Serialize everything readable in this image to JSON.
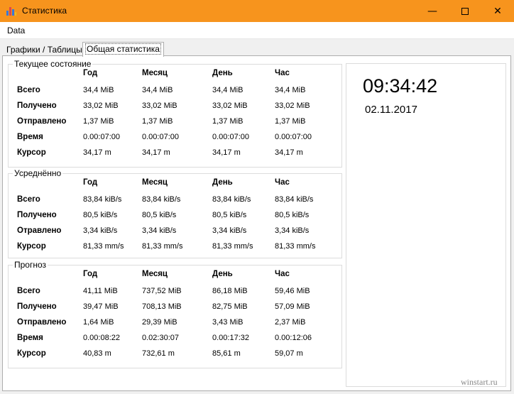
{
  "window": {
    "title": "Статистика"
  },
  "menu": {
    "items": [
      "Data"
    ]
  },
  "tabs": [
    "Графики / Таблицы",
    "Общая статистика"
  ],
  "columns": [
    "Год",
    "Месяц",
    "День",
    "Час"
  ],
  "groups": [
    {
      "title": "Текущее состояние",
      "rows": [
        {
          "label": "Всего",
          "values": [
            "34,4 MiB",
            "34,4 MiB",
            "34,4 MiB",
            "34,4 MiB"
          ]
        },
        {
          "label": "Получено",
          "values": [
            "33,02 MiB",
            "33,02 MiB",
            "33,02 MiB",
            "33,02 MiB"
          ]
        },
        {
          "label": "Отправлено",
          "values": [
            "1,37 MiB",
            "1,37 MiB",
            "1,37 MiB",
            "1,37 MiB"
          ]
        },
        {
          "label": "Время",
          "values": [
            "0.00:07:00",
            "0.00:07:00",
            "0.00:07:00",
            "0.00:07:00"
          ]
        },
        {
          "label": "Курсор",
          "values": [
            "34,17 m",
            "34,17 m",
            "34,17 m",
            "34,17 m"
          ]
        }
      ]
    },
    {
      "title": "Усреднённо",
      "rows": [
        {
          "label": "Всего",
          "values": [
            "83,84 kiB/s",
            "83,84 kiB/s",
            "83,84 kiB/s",
            "83,84 kiB/s"
          ]
        },
        {
          "label": "Получено",
          "values": [
            "80,5 kiB/s",
            "80,5 kiB/s",
            "80,5 kiB/s",
            "80,5 kiB/s"
          ]
        },
        {
          "label": "Отравлено",
          "values": [
            "3,34 kiB/s",
            "3,34 kiB/s",
            "3,34 kiB/s",
            "3,34 kiB/s"
          ]
        },
        {
          "label": "Курсор",
          "values": [
            "81,33 mm/s",
            "81,33 mm/s",
            "81,33 mm/s",
            "81,33 mm/s"
          ]
        }
      ]
    },
    {
      "title": "Прогноз",
      "rows": [
        {
          "label": "Всего",
          "values": [
            "41,11 MiB",
            "737,52 MiB",
            "86,18 MiB",
            "59,46 MiB"
          ]
        },
        {
          "label": "Получено",
          "values": [
            "39,47 MiB",
            "708,13 MiB",
            "82,75 MiB",
            "57,09 MiB"
          ]
        },
        {
          "label": "Отправлено",
          "values": [
            "1,64 MiB",
            "29,39 MiB",
            "3,43 MiB",
            "2,37 MiB"
          ]
        },
        {
          "label": "Время",
          "values": [
            "0.00:08:22",
            "0.02:30:07",
            "0.00:17:32",
            "0.00:12:06"
          ]
        },
        {
          "label": "Курсор",
          "values": [
            "40,83 m",
            "732,61 m",
            "85,61 m",
            "59,07 m"
          ]
        }
      ]
    }
  ],
  "clock": {
    "time": "09:34:42",
    "date": "02.11.2017"
  },
  "watermark": "winstart.ru",
  "colors": {
    "titlebar": "#f7941d"
  }
}
